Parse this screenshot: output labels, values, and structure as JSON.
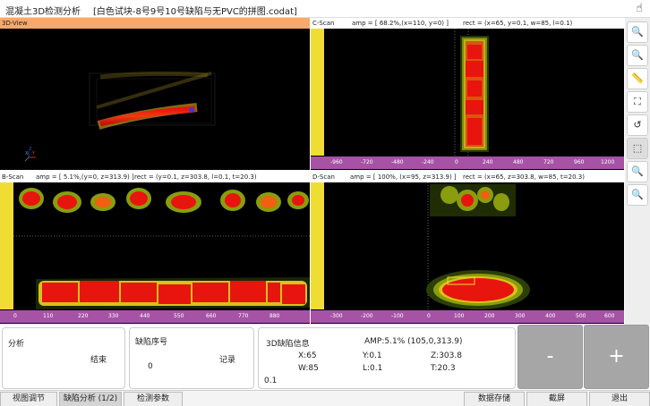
{
  "app": {
    "title": "混凝土3D检测分析",
    "file": "[白色试块-8号9号10号缺陷与无PVC的拼图.codat]"
  },
  "views": {
    "view3d": {
      "label": "3D-View",
      "axis_x": "X",
      "axis_y": "Y",
      "axis_z": "Z"
    },
    "cscan": {
      "label": "C-Scan",
      "amp": "amp = [ 68.2%,(x=110, y=0) ]",
      "rect": "rect = (x=65, y=0.1, w=85, l=0.1)",
      "ticks": [
        "-960",
        "-720",
        "-480",
        "-240",
        "0",
        "240",
        "480",
        "720",
        "960",
        "1200"
      ]
    },
    "bscan": {
      "label": "B-Scan",
      "amp": "amp = [ 5.1%,(y=0, z=313.9) ]",
      "rect": "rect = (y=0.1, z=303.8, l=0.1, t=20.3)",
      "ticks": [
        "0",
        "110",
        "220",
        "330",
        "440",
        "550",
        "660",
        "770",
        "880"
      ]
    },
    "dscan": {
      "label": "D-Scan",
      "amp": "amp = [ 100%, (x=95, z=313.9) ]",
      "rect": "rect = (x=65, z=303.8, w=85, t=20.3)",
      "ticks": [
        "-300",
        "-200",
        "-100",
        "0",
        "100",
        "200",
        "300",
        "400",
        "500",
        "600"
      ]
    }
  },
  "sidebar": {
    "icons": [
      "zoom-in-icon",
      "zoom-out-icon",
      "ruler-icon",
      "fit-screen-icon",
      "reset-icon",
      "select-region-icon",
      "zoom-in-icon-2",
      "zoom-out-icon-2"
    ]
  },
  "bottom": {
    "analysis": {
      "label": "分析",
      "end": "结束"
    },
    "defect_no": {
      "label": "缺陷序号",
      "value": "0",
      "record": "记录"
    },
    "info": {
      "title": "3D缺陷信息",
      "amp": "AMP:5.1% (105,0,313.9)",
      "x": "X:65",
      "y": "Y:0.1",
      "z": "Z:303.8",
      "w": "W:85",
      "l": "L:0.1",
      "t": "T:20.3",
      "extra": "0.1"
    },
    "minus": "-",
    "plus": "+"
  },
  "tabs": {
    "view_adjust": "视图调节",
    "defect_analysis": "缺陷分析 (1/2)",
    "params": "检测参数",
    "save": "数据存储",
    "screenshot": "截屏",
    "exit": "退出"
  },
  "colors": {
    "ruler_vertical": "#f0dd33",
    "ruler_horizontal": "#a653a6",
    "panel_3d_header": "#f7a96b",
    "defect_red": "#e8140e"
  }
}
